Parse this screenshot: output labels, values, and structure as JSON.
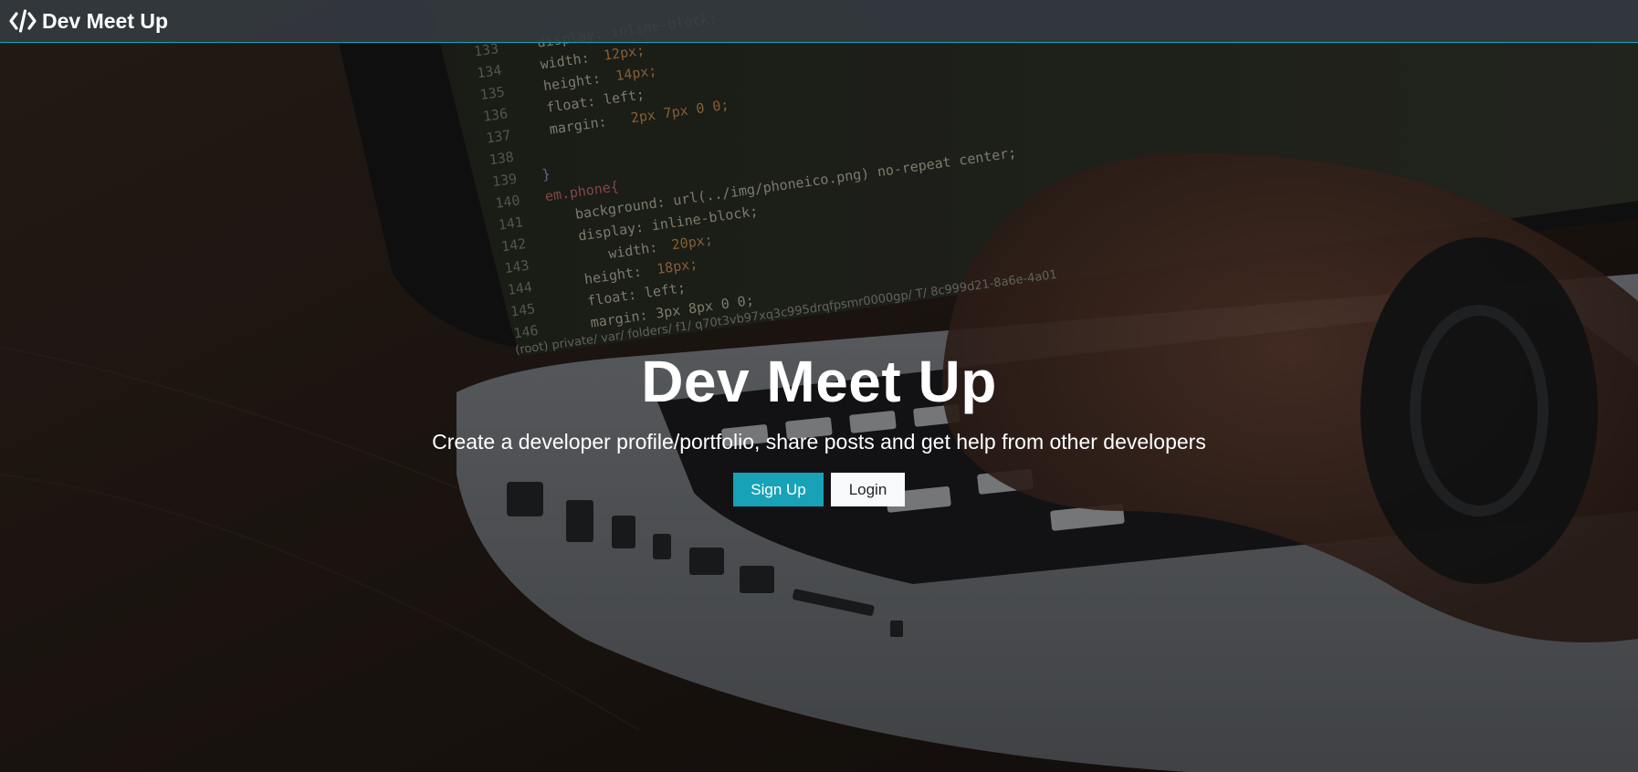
{
  "navbar": {
    "brand_icon": "code-icon",
    "brand_label": "Dev Meet Up",
    "accent_color": "#17a2b8"
  },
  "hero": {
    "title": "Dev Meet Up",
    "lead": "Create a developer profile/portfolio, share posts and get help from other developers",
    "signup_label": "Sign Up",
    "login_label": "Login"
  },
  "background": {
    "code_lines": [
      {
        "num": "133",
        "text": "display: inline-block;"
      },
      {
        "num": "134",
        "text": "width: 12px;"
      },
      {
        "num": "135",
        "text": "height: 14px;"
      },
      {
        "num": "136",
        "text": "float: left;"
      },
      {
        "num": "137",
        "text": "margin: 2px 7px 0 0;"
      },
      {
        "num": "138",
        "text": ""
      },
      {
        "num": "139",
        "text": "}"
      },
      {
        "num": "140",
        "text": "em.phone{"
      },
      {
        "num": "141",
        "text": "background: url(../img/phoneico.png) no-repeat center;"
      },
      {
        "num": "142",
        "text": "display: inline-block;"
      },
      {
        "num": "143",
        "text": "width: 20px;"
      },
      {
        "num": "144",
        "text": "height: 18px;"
      },
      {
        "num": "145",
        "text": "float: left;"
      },
      {
        "num": "146",
        "text": "margin: 3px 8px 0 0;"
      }
    ],
    "status_path": "(root) private/ var/ folders/ f1/ q70t3vb97xq3c995drqfpsmr0000gp/ T/ 8c999d21-8a6e-4a01"
  },
  "colors": {
    "navbar_bg": "#343a40",
    "signup_bg": "#17a2b8",
    "login_bg": "#f8f9fa"
  }
}
